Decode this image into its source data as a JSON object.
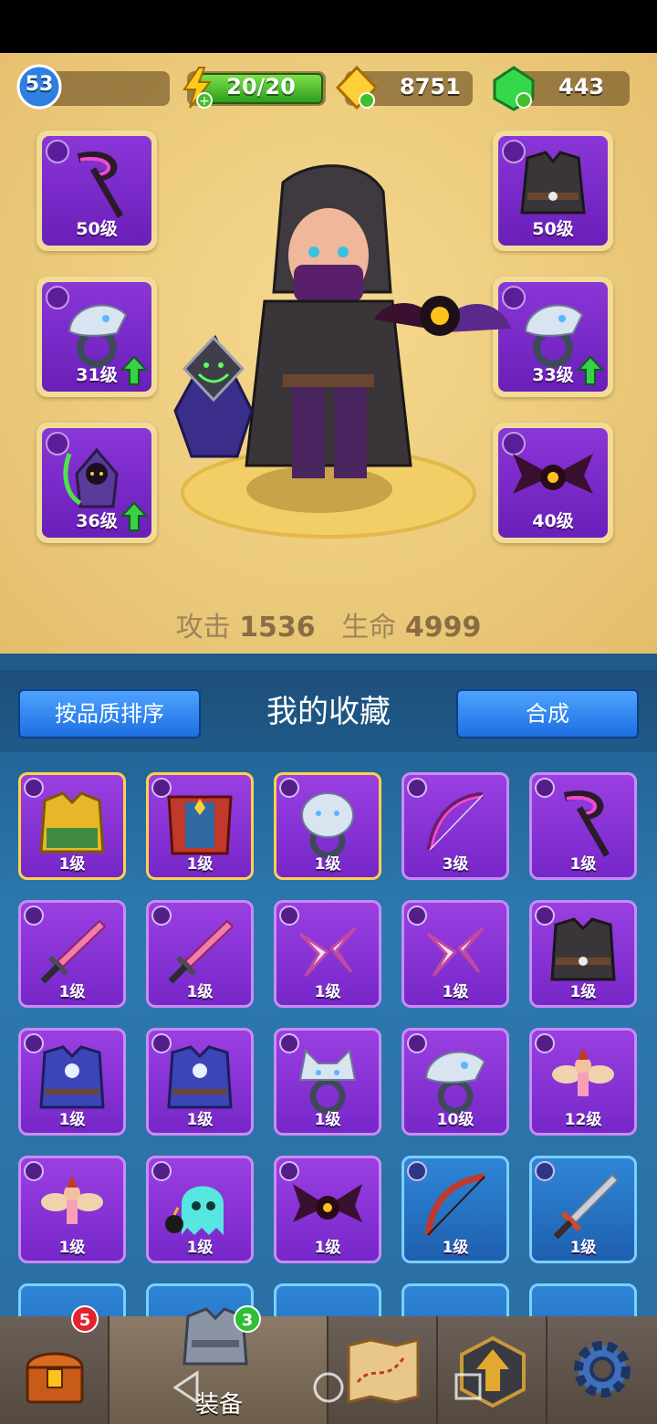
{
  "status": {
    "player_level": "53",
    "energy": "20/20",
    "energy_fill": 1.0,
    "gold": "8751",
    "gems": "443"
  },
  "hero_panel": {
    "left_slots": [
      {
        "type": "weapon",
        "level": "50级",
        "upgrade": false
      },
      {
        "type": "ring",
        "level": "31级",
        "upgrade": true
      },
      {
        "type": "pet",
        "level": "36级",
        "upgrade": true
      }
    ],
    "right_slots": [
      {
        "type": "armor",
        "level": "50级",
        "upgrade": false
      },
      {
        "type": "ring",
        "level": "33级",
        "upgrade": true
      },
      {
        "type": "pet",
        "level": "40级",
        "upgrade": false
      }
    ],
    "stats": {
      "attack_label": "攻击",
      "attack_value": "1536",
      "hp_label": "生命",
      "hp_value": "4999"
    }
  },
  "collection": {
    "sort_button": "按品质排序",
    "title": "我的收藏",
    "merge_button": "合成",
    "items": [
      {
        "icon": "golden-armor-icon",
        "level": "1级",
        "color": "purple",
        "gold": true
      },
      {
        "icon": "red-cape-armor-icon",
        "level": "1级",
        "color": "purple",
        "gold": true
      },
      {
        "icon": "bear-ring-icon",
        "level": "1级",
        "color": "purple",
        "gold": true
      },
      {
        "icon": "bow-icon",
        "level": "3级",
        "color": "purple",
        "gold": false
      },
      {
        "icon": "scythe-icon",
        "level": "1级",
        "color": "purple",
        "gold": false
      },
      {
        "icon": "pink-sword-icon",
        "level": "1级",
        "color": "purple",
        "gold": false
      },
      {
        "icon": "pink-sword-icon",
        "level": "1级",
        "color": "purple",
        "gold": false
      },
      {
        "icon": "shuriken-icon",
        "level": "1级",
        "color": "purple",
        "gold": false
      },
      {
        "icon": "shuriken-icon",
        "level": "1级",
        "color": "purple",
        "gold": false
      },
      {
        "icon": "dark-armor-icon",
        "level": "1级",
        "color": "purple",
        "gold": false
      },
      {
        "icon": "blue-robe-icon",
        "level": "1级",
        "color": "purple",
        "gold": false
      },
      {
        "icon": "blue-robe-icon",
        "level": "1级",
        "color": "purple",
        "gold": false
      },
      {
        "icon": "wolf-ring-icon",
        "level": "1级",
        "color": "purple",
        "gold": false
      },
      {
        "icon": "serpent-ring-icon",
        "level": "10级",
        "color": "purple",
        "gold": false
      },
      {
        "icon": "fairy-pet-icon",
        "level": "12级",
        "color": "purple",
        "gold": false
      },
      {
        "icon": "fairy-pet-icon",
        "level": "1级",
        "color": "purple",
        "gold": false
      },
      {
        "icon": "ghost-pet-icon",
        "level": "1级",
        "color": "purple",
        "gold": false
      },
      {
        "icon": "bat-eye-pet-icon",
        "level": "1级",
        "color": "purple",
        "gold": false
      },
      {
        "icon": "red-bow-icon",
        "level": "1级",
        "color": "blue",
        "gold": false
      },
      {
        "icon": "serrated-sword-icon",
        "level": "1级",
        "color": "blue",
        "gold": false
      }
    ]
  },
  "bottom_nav": {
    "shop_badge": "5",
    "equip_badge": "3",
    "equip_label": "装备"
  }
}
